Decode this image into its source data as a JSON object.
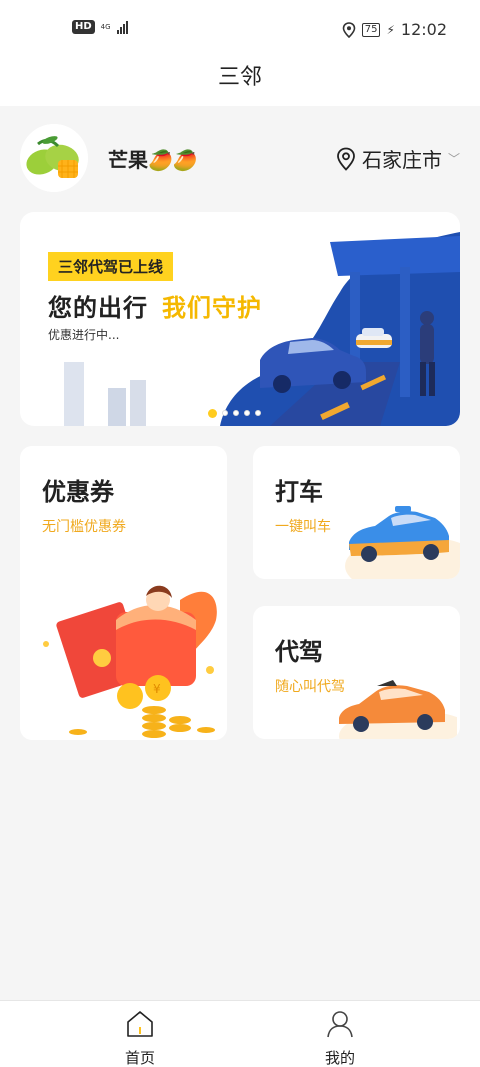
{
  "status_bar": {
    "hd": "HD",
    "network": "4G",
    "battery": "75",
    "time": "12:02"
  },
  "header": {
    "title": "三邻"
  },
  "profile": {
    "username": "芒果🥭🥭",
    "city": "石家庄市"
  },
  "banner": {
    "tag": "三邻代驾已上线",
    "headline_main": "您的出行",
    "headline_accent": "我们守护",
    "subtitle": "优惠进行中...",
    "dots_count": 5,
    "active_dot": 1
  },
  "cards": {
    "coupon": {
      "title": "优惠券",
      "subtitle": "无门槛优惠券"
    },
    "taxi": {
      "title": "打车",
      "subtitle": "一键叫车"
    },
    "driver": {
      "title": "代驾",
      "subtitle": "随心叫代驾"
    }
  },
  "tabbar": {
    "home": "首页",
    "mine": "我的"
  },
  "colors": {
    "accent": "#ffd21f",
    "subtitle": "#f0a91e",
    "banner_blue": "#1f4fb0"
  }
}
